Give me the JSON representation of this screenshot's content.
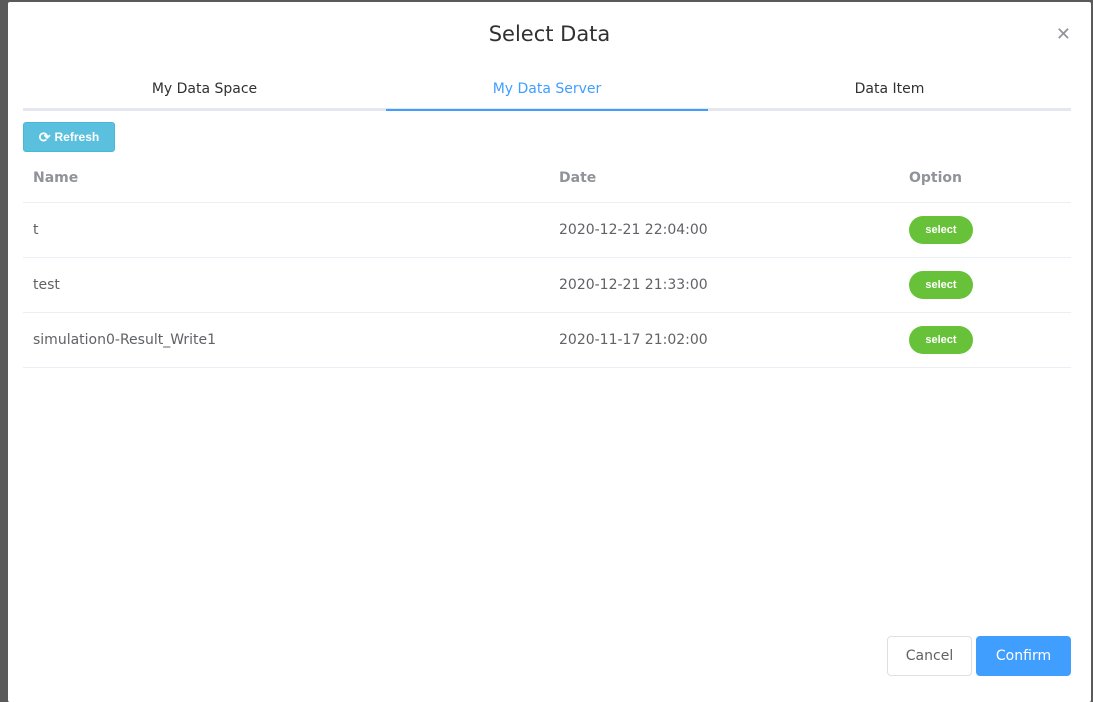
{
  "dialog": {
    "title": "Select Data",
    "close_icon": "close-icon"
  },
  "tabs": [
    {
      "label": "My Data Space"
    },
    {
      "label": "My Data Server",
      "active": true
    },
    {
      "label": "Data Item"
    }
  ],
  "toolbar": {
    "refresh_label": "Refresh",
    "refresh_icon": "refresh-icon"
  },
  "table": {
    "headers": [
      "Name",
      "Date",
      "Option"
    ],
    "rows": [
      {
        "name": "t",
        "date": "2020-12-21 22:04:00",
        "option": "select"
      },
      {
        "name": "test",
        "date": "2020-12-21 21:33:00",
        "option": "select"
      },
      {
        "name": "simulation0-Result_Write1",
        "date": "2020-11-17 21:02:00",
        "option": "select"
      }
    ]
  },
  "footer": {
    "cancel_label": "Cancel",
    "confirm_label": "Confirm"
  },
  "colors": {
    "accent": "#409eff",
    "select": "#67c23a",
    "refresh": "#5bc0de"
  }
}
